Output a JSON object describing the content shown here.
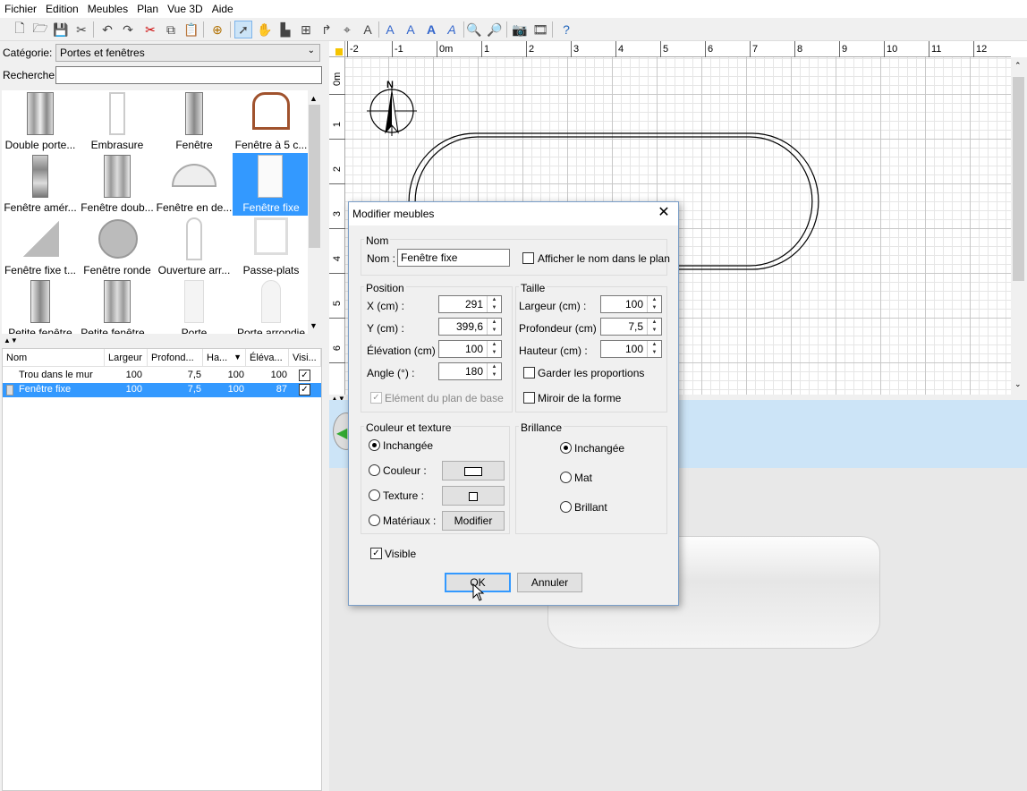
{
  "menu": [
    "Fichier",
    "Edition",
    "Meubles",
    "Plan",
    "Vue 3D",
    "Aide"
  ],
  "left": {
    "category_label": "Catégorie:",
    "category_value": "Portes et fenêtres",
    "search_label": "Recherche:",
    "search_value": "",
    "catalog": [
      [
        "Double porte...",
        "Embrasure",
        "Fenêtre",
        "Fenêtre à 5 c..."
      ],
      [
        "Fenêtre amér...",
        "Fenêtre doub...",
        "Fenêtre en de...",
        "Fenêtre fixe"
      ],
      [
        "Fenêtre fixe t...",
        "Fenêtre ronde",
        "Ouverture arr...",
        "Passe-plats"
      ],
      [
        "Petite fenêtre",
        "Petite fenêtre...",
        "Porte",
        "Porte arrondie"
      ]
    ],
    "table": {
      "headers": [
        "Nom",
        "Largeur",
        "Profond...",
        "Ha...",
        "Éléva...",
        "Visi..."
      ],
      "rows": [
        {
          "name": "Trou dans le mur",
          "w": "100",
          "d": "7,5",
          "h": "100",
          "e": "100",
          "v": "✓"
        },
        {
          "name": "Fenêtre fixe",
          "w": "100",
          "d": "7,5",
          "h": "100",
          "e": "87",
          "v": "✓"
        }
      ]
    }
  },
  "plan": {
    "hruler": [
      "-2",
      "-1",
      "0m",
      "1",
      "2",
      "3",
      "4",
      "5",
      "6",
      "7",
      "8",
      "9",
      "10",
      "11",
      "12"
    ],
    "vruler": [
      "0m",
      "1",
      "2",
      "3",
      "4",
      "5",
      "6"
    ],
    "compass_letter": "N"
  },
  "dialog": {
    "title": "Modifier meubles",
    "close": "✕",
    "nom_group": "Nom",
    "nom_label": "Nom :",
    "nom_value": "Fenêtre fixe",
    "show_name": "Afficher le nom dans le plan",
    "position_group": "Position",
    "x_label": "X (cm) :",
    "x_value": "291",
    "y_label": "Y (cm) :",
    "y_value": "399,6",
    "elev_label": "Élévation (cm) :",
    "elev_value": "100",
    "angle_label": "Angle (°) :",
    "angle_value": "180",
    "base_plan": "Elément du plan de base",
    "taille_group": "Taille",
    "width_label": "Largeur (cm) :",
    "width_value": "100",
    "depth_label": "Profondeur (cm) :",
    "depth_value": "7,5",
    "height_label": "Hauteur (cm) :",
    "height_value": "100",
    "keep_prop": "Garder les proportions",
    "mirror": "Miroir de la forme",
    "color_group": "Couleur et texture",
    "unchanged": "Inchangée",
    "color": "Couleur :",
    "texture": "Texture :",
    "materials": "Matériaux :",
    "modify": "Modifier",
    "shine_group": "Brillance",
    "shine_unchanged": "Inchangée",
    "matte": "Mat",
    "shiny": "Brillant",
    "visible": "Visible",
    "ok": "OK",
    "cancel": "Annuler"
  }
}
